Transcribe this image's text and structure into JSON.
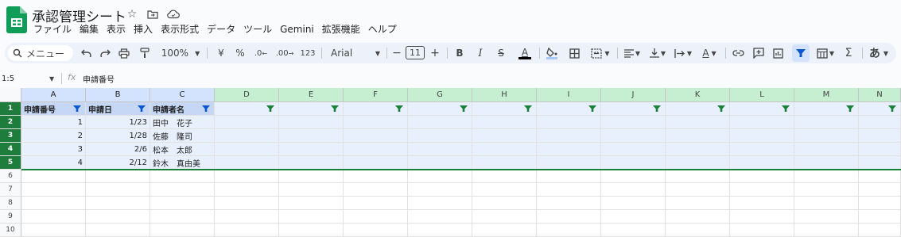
{
  "doc": {
    "title": "承認管理シート"
  },
  "menu": [
    "ファイル",
    "編集",
    "表示",
    "挿入",
    "表示形式",
    "データ",
    "ツール",
    "Gemini",
    "拡張機能",
    "ヘルプ"
  ],
  "toolbar": {
    "search_label": "メニュー",
    "zoom": "100%",
    "currency": "¥",
    "percent": "%",
    "dec_decrease": ".0",
    "dec_increase": ".00",
    "number_format": "123",
    "font": "Arial",
    "font_size": "11",
    "sigma": "Σ",
    "ime": "あ"
  },
  "formula_bar": {
    "name_box": "1:5",
    "fx": "fx",
    "content": "申請番号"
  },
  "columns": [
    "A",
    "B",
    "C",
    "D",
    "E",
    "F",
    "G",
    "H",
    "I",
    "J",
    "K",
    "L",
    "M",
    "N"
  ],
  "rows": [
    "1",
    "2",
    "3",
    "4",
    "5",
    "6",
    "7",
    "8",
    "9",
    "10"
  ],
  "table": {
    "headers": [
      "申請番号",
      "申請日",
      "申請者名"
    ],
    "data": [
      [
        "1",
        "1/23",
        "田中　花子"
      ],
      [
        "2",
        "1/28",
        "佐藤　隆司"
      ],
      [
        "3",
        "2/6",
        "松本　太郎"
      ],
      [
        "4",
        "2/12",
        "鈴木　真由美"
      ]
    ]
  },
  "colors": {
    "accent_green": "#188038",
    "selection": "#d3e3fd",
    "filter_header": "#c6efd2"
  }
}
